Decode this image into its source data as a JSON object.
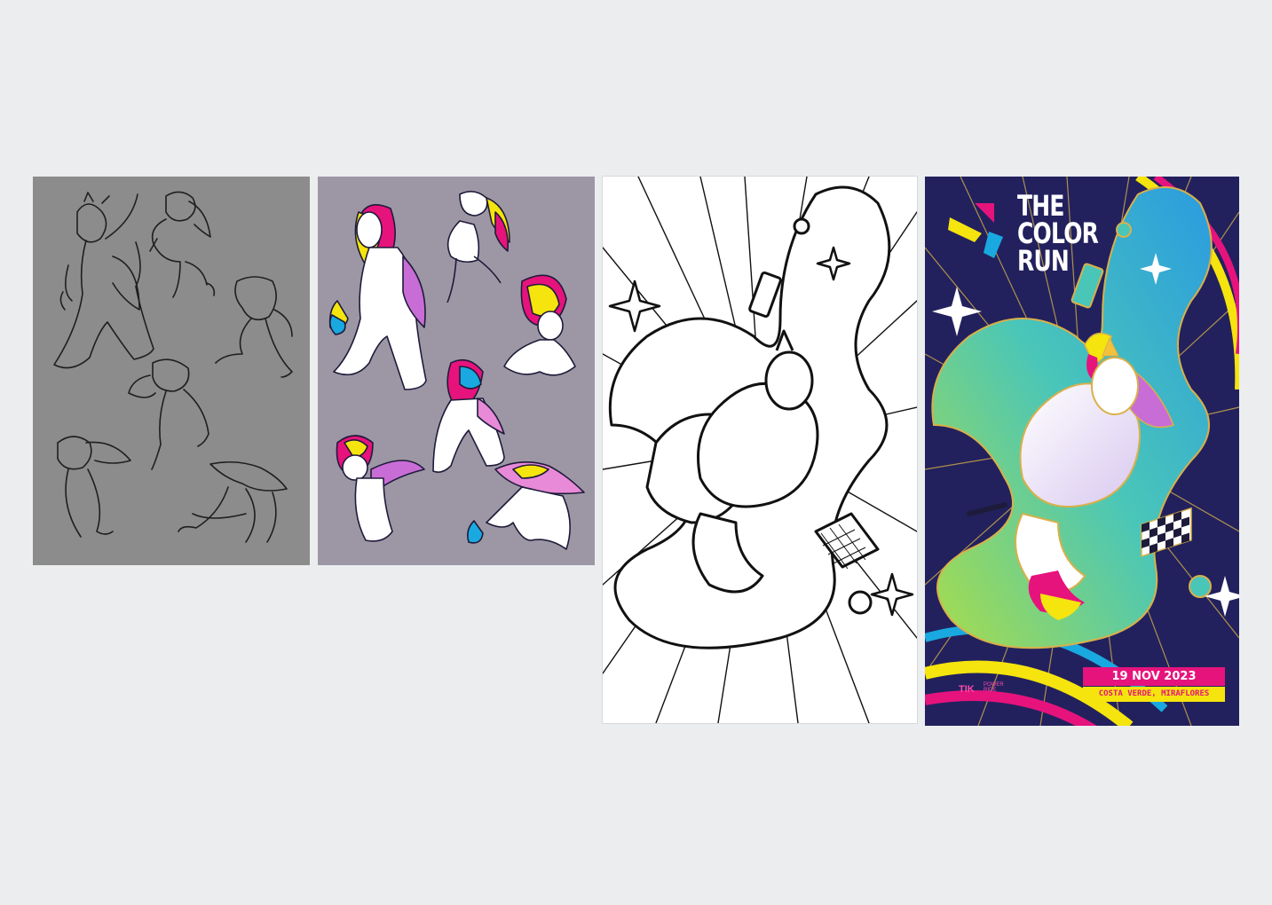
{
  "poster": {
    "title_lines": [
      "THE",
      "COLOR",
      "RUN"
    ],
    "date": "19 NOV 2023",
    "location": "COSTA VERDE, MIRAFLORES",
    "sponsor_mark": "TIK",
    "sponsor_name": "POWER RIDE"
  },
  "colors": {
    "page_bg": "#ebedef",
    "sketch_bg": "#8c8c8c",
    "color_sheet_bg": "#9d97a5",
    "poster_bg": "#22215e",
    "brand_pink": "#e6137d",
    "brand_yellow": "#f5e40d",
    "brand_cyan": "#19a9e0"
  },
  "panels": [
    {
      "name": "sketch-sheet",
      "content": "unicode-poses-pencil"
    },
    {
      "name": "color-sheet",
      "content": "unicode-poses-colored"
    },
    {
      "name": "lineart-poster",
      "content": "unicorn-lineart"
    },
    {
      "name": "final-poster",
      "content": "unicorn-final"
    }
  ]
}
